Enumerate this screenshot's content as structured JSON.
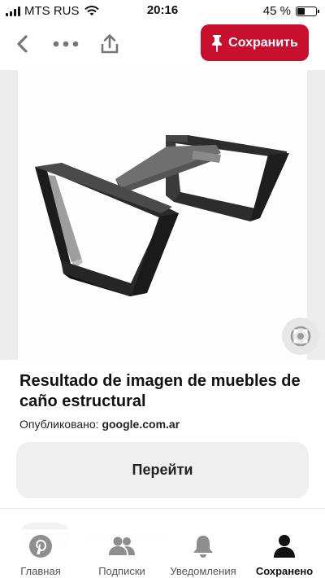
{
  "status_bar": {
    "carrier": "MTS RUS",
    "time": "20:16",
    "battery": "45 %",
    "battery_level": 0.45
  },
  "toolbar": {
    "back_icon": "chevron-left-icon",
    "more_icon": "more-dots-icon",
    "share_icon": "share-upload-icon",
    "save_label": "Сохранить",
    "save_icon": "pin-icon",
    "brand_color": "#c8102e"
  },
  "pin": {
    "image_alt": "steel tube table legs",
    "lens_icon": "visual-search-icon",
    "title": "Resultado de imagen de muebles de caño estructural",
    "published_label": "Опубликовано:",
    "published_source": "google.com.ar",
    "visit_label": "Перейти"
  },
  "bottom_nav": {
    "items": [
      {
        "label": "Главная",
        "icon": "pinterest-logo-icon",
        "active": false
      },
      {
        "label": "Подписки",
        "icon": "people-icon",
        "active": false
      },
      {
        "label": "Уведомления",
        "icon": "bell-icon",
        "active": false
      },
      {
        "label": "Сохранено",
        "icon": "profile-icon",
        "active": true
      }
    ]
  }
}
